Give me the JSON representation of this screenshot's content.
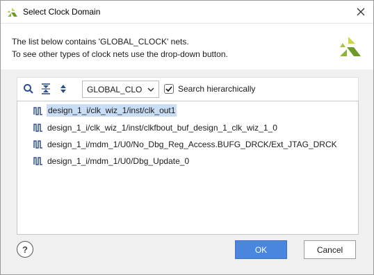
{
  "window": {
    "title": "Select Clock Domain",
    "icon": "vivado-logo-icon",
    "close_icon": "close-icon"
  },
  "header": {
    "line1": "The list below contains 'GLOBAL_CLOCK' nets.",
    "line2": "To see other types of clock nets use the drop-down button.",
    "logo": "vivado-logo-icon"
  },
  "toolbar": {
    "search_icon": "search-icon",
    "collapse_icon": "collapse-all-icon",
    "expand_icon": "expand-all-icon",
    "combo_value": "GLOBAL_CLOCK",
    "search_hier_checked": true,
    "search_hier_label": "Search hierarchically"
  },
  "list": {
    "items": [
      {
        "label": "design_1_i/clk_wiz_1/inst/clk_out1",
        "icon": "clock-net-icon",
        "selected": true
      },
      {
        "label": "design_1_i/clk_wiz_1/inst/clkfbout_buf_design_1_clk_wiz_1_0",
        "icon": "clock-net-icon",
        "selected": false
      },
      {
        "label": "design_1_i/mdm_1/U0/No_Dbg_Reg_Access.BUFG_DRCK/Ext_JTAG_DRCK",
        "icon": "clock-net-icon",
        "selected": false
      },
      {
        "label": "design_1_i/mdm_1/U0/Dbg_Update_0",
        "icon": "clock-net-icon",
        "selected": false
      }
    ]
  },
  "footer": {
    "help_label": "?",
    "ok_label": "OK",
    "cancel_label": "Cancel"
  },
  "colors": {
    "accent": "#4a86dd",
    "selection": "#c9def5",
    "clock_icon": "#2a4f8f",
    "logo_green": "#8db43a"
  }
}
